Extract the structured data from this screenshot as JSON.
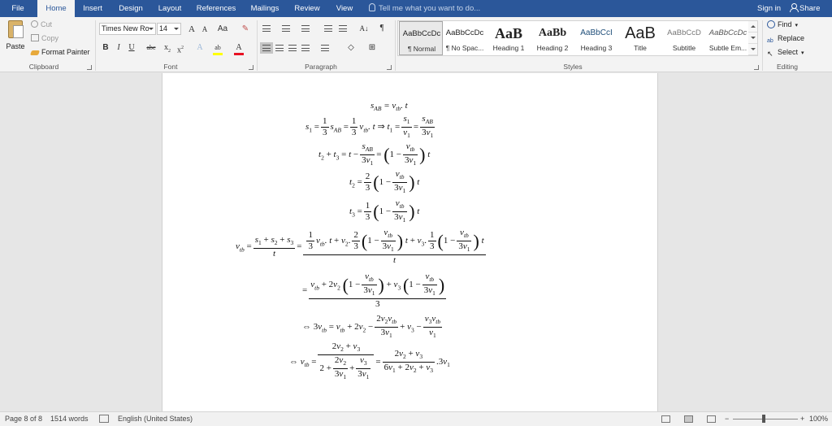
{
  "tabs": [
    "File",
    "Home",
    "Insert",
    "Design",
    "Layout",
    "References",
    "Mailings",
    "Review",
    "View"
  ],
  "active_tab": "Home",
  "tell_me": "Tell me what you want to do...",
  "account": {
    "sign_in": "Sign in",
    "share": "Share"
  },
  "clipboard": {
    "paste": "Paste",
    "cut": "Cut",
    "copy": "Copy",
    "format_painter": "Format Painter",
    "group": "Clipboard"
  },
  "font": {
    "name": "Times New Ro",
    "size": "14",
    "group": "Font",
    "grow": "A",
    "shrink": "A",
    "case": "Aa",
    "bold": "B",
    "italic": "I",
    "underline": "U",
    "strike": "abc",
    "sub": "x",
    "sup": "x"
  },
  "paragraph": {
    "group": "Paragraph"
  },
  "styles": {
    "group": "Styles",
    "items": [
      {
        "preview": "AaBbCcDc",
        "name": "¶ Normal"
      },
      {
        "preview": "AaBbCcDc",
        "name": "¶ No Spac..."
      },
      {
        "preview": "AaB",
        "name": "Heading 1"
      },
      {
        "preview": "AaBb",
        "name": "Heading 2"
      },
      {
        "preview": "AaBbCcI",
        "name": "Heading 3"
      },
      {
        "preview": "AaB",
        "name": "Title"
      },
      {
        "preview": "AaBbCcD",
        "name": "Subtitle"
      },
      {
        "preview": "AaBbCcDc",
        "name": "Subtle Em..."
      }
    ]
  },
  "editing": {
    "find": "Find",
    "replace": "Replace",
    "select": "Select",
    "group": "Editing"
  },
  "document": {
    "eq1": {
      "lhs": "s",
      "lhs_sub": "AB",
      "rhs": "= v",
      "rhs_sub": "tb",
      "tail": ". t"
    }
  },
  "status": {
    "page": "Page 8 of 8",
    "words": "1514 words",
    "language": "English (United States)",
    "zoom": "100%"
  },
  "colors": {
    "accent": "#2b579a",
    "ribbon": "#f3f3f3",
    "highlight": "#ffff00",
    "font_color": "#e81123"
  }
}
